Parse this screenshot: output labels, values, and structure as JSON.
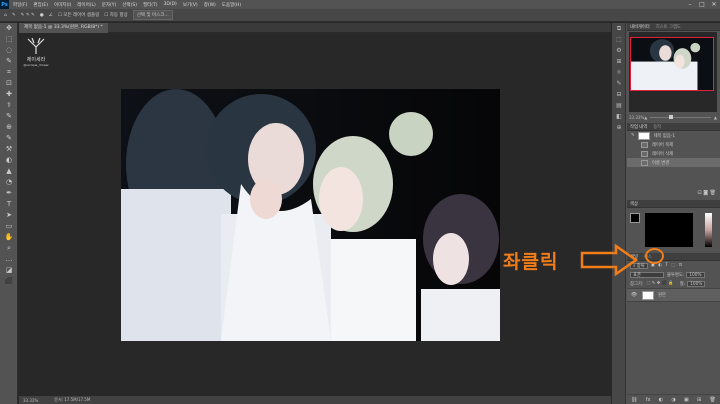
{
  "app": {
    "logo": "Ps"
  },
  "menubar": {
    "items": [
      "파일(F)",
      "편집(E)",
      "이미지(I)",
      "레이어(L)",
      "문자(Y)",
      "선택(S)",
      "필터(T)",
      "3D(D)",
      "보기(V)",
      "창(W)",
      "도움말(H)"
    ],
    "window_controls": [
      "–",
      "□",
      "✕"
    ]
  },
  "options_bar": {
    "items": [
      "모든 레이어 샘플링",
      "자동 향상"
    ],
    "button": "선택 및 마스크..."
  },
  "document": {
    "tab_title": "제목 없음-1 @ 33.3%(원본, RGB/8*) *",
    "zoom": "33.33%",
    "doc_info": "문서: 17.5M/17.5M"
  },
  "watermark": {
    "name": "제이세라",
    "handle": "@sorique_rimeer"
  },
  "tools": [
    "✥",
    "⬚",
    "◌",
    "✎",
    "⌗",
    "⊡",
    "✚",
    "⚕",
    "✎",
    "⊕",
    "✎",
    "⚒",
    "◐",
    "▲",
    "◔",
    "✒",
    "T",
    "➤",
    "▭",
    "✋",
    "⌕",
    "…",
    "◪",
    "⬛"
  ],
  "icon_strip": [
    "⧉",
    "⬚",
    "⚙",
    "⊞",
    "⚛",
    "✎",
    "⊟",
    "▤",
    "◧",
    "⊕"
  ],
  "navigator": {
    "tabs": [
      "내비게이터",
      "히스토 그램도"
    ],
    "zoom": "33.33%"
  },
  "history": {
    "tabs": [
      "작업 내역",
      "동작"
    ],
    "snapshot": "제목 없음-1",
    "items": [
      "레이어 복제",
      "레이어 삭제",
      "이름 변경"
    ],
    "selected_index": 2
  },
  "color_panel": {
    "tab": "색상",
    "foreground": "#000000"
  },
  "layers": {
    "tabs": [
      "채널",
      "패스"
    ],
    "search_label": "종류",
    "blend_mode": "표준",
    "opacity_label": "불투명도:",
    "opacity": "100%",
    "lock_label": "잠그기:",
    "fill_label": "칠:",
    "fill": "100%",
    "layer_name": "원본",
    "bottom_icons": [
      "⛓",
      "fx",
      "◐",
      "◑",
      "▣",
      "⊞",
      "🗑"
    ]
  },
  "annotation": {
    "text": "좌클릭",
    "color": "#f07d1a"
  }
}
